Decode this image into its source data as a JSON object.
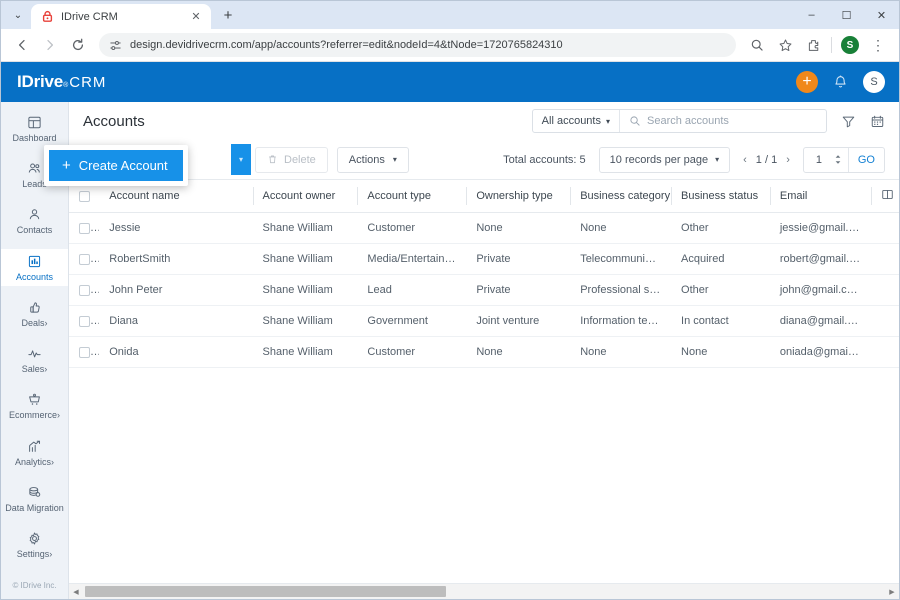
{
  "browser": {
    "tab": {
      "title": "IDrive CRM",
      "favicon": "idrive-lock-icon",
      "close": "✕"
    },
    "tab_list_glyph": "⌄",
    "new_tab_glyph": "+",
    "window_controls": {
      "minimize": "–",
      "maximize": "☐",
      "close": "✕"
    },
    "nav": {
      "back": "←",
      "forward": "→",
      "reload": "⟳"
    },
    "url": "design.devidrivecrm.com/app/accounts?referrer=edit&nodeId=4&tNode=1720765824310",
    "profile_initial": "S",
    "menu_glyph": "⋮"
  },
  "appbar": {
    "logo": {
      "name": "IDrive",
      "reg": "®",
      "suffix": "CRM"
    },
    "add_glyph": "+",
    "avatar_initial": "S"
  },
  "sidebar": {
    "items": [
      {
        "label": "Dashboard",
        "icon": "dashboard-icon",
        "chevron": "",
        "active": false
      },
      {
        "label": "Leads",
        "icon": "leads-icon",
        "chevron": "",
        "active": false
      },
      {
        "label": "Contacts",
        "icon": "contacts-icon",
        "chevron": "",
        "active": false
      },
      {
        "label": "Accounts",
        "icon": "accounts-icon",
        "chevron": "",
        "active": true
      },
      {
        "label": "Deals",
        "icon": "deals-icon",
        "chevron": "›",
        "active": false
      },
      {
        "label": "Sales",
        "icon": "sales-icon",
        "chevron": "›",
        "active": false
      },
      {
        "label": "Ecommerce",
        "icon": "ecommerce-icon",
        "chevron": "›",
        "active": false
      },
      {
        "label": "Analytics",
        "icon": "analytics-icon",
        "chevron": "›",
        "active": false
      },
      {
        "label": "Data Migration",
        "icon": "data-migration-icon",
        "chevron": "",
        "active": false
      },
      {
        "label": "Settings",
        "icon": "settings-icon",
        "chevron": "›",
        "active": false
      }
    ],
    "copyright": "© IDrive Inc."
  },
  "page": {
    "title": "Accounts",
    "view_filter": {
      "label": "All accounts",
      "caret": "▾"
    },
    "search": {
      "placeholder": "Search accounts",
      "value": ""
    }
  },
  "toolbar": {
    "create_label": "Create Account",
    "create_plus": "+",
    "create_caret": "▾",
    "delete_label": "Delete",
    "actions_label": "Actions",
    "actions_caret": "▾",
    "total_label": "Total accounts:",
    "total_value": "5",
    "records_per_page": "10 records per page",
    "rpp_caret": "▾",
    "page_prev": "‹",
    "page_indicator": "1 / 1",
    "page_next": "›",
    "page_input": "1",
    "go_label": "GO"
  },
  "table": {
    "columns": [
      "Account name",
      "Account owner",
      "Account type",
      "Ownership type",
      "Business category",
      "Business status",
      "Email"
    ],
    "rows": [
      {
        "name": "Jessie",
        "owner": "Shane William",
        "type": "Customer",
        "ownership": "None",
        "category": "None",
        "status": "Other",
        "email": "jessie@gmail.com"
      },
      {
        "name": "RobertSmith",
        "owner": "Shane William",
        "type": "Media/Entertainment",
        "ownership": "Private",
        "category": "Telecommunications",
        "status": "Acquired",
        "email": "robert@gmail.com"
      },
      {
        "name": "John Peter",
        "owner": "Shane William",
        "type": "Lead",
        "ownership": "Private",
        "category": "Professional services",
        "status": "Other",
        "email": "john@gmail.com"
      },
      {
        "name": "Diana",
        "owner": "Shane William",
        "type": "Government",
        "ownership": "Joint venture",
        "category": "Information technol...",
        "status": "In contact",
        "email": "diana@gmail.com"
      },
      {
        "name": "Onida",
        "owner": "Shane William",
        "type": "Customer",
        "ownership": "None",
        "category": "None",
        "status": "None",
        "email": "oniada@gmail.com"
      }
    ]
  },
  "scrollbar": {
    "left_arrow": "◀",
    "right_arrow": "▶"
  },
  "colors": {
    "brand_blue": "#0770c5",
    "button_blue": "#1791e8",
    "accent_orange": "#f0881a",
    "sidebar_bg": "#eef2f7",
    "link_blue": "#1682d4"
  }
}
